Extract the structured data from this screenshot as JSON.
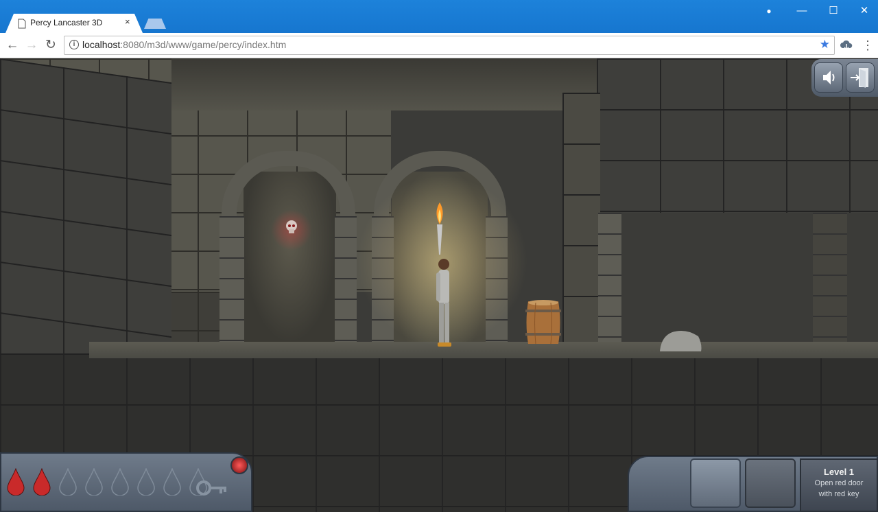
{
  "browser": {
    "tab_title": "Percy Lancaster 3D",
    "tab_close": "×",
    "url_host": "localhost",
    "url_path": ":8080/m3d/www/game/percy/index.htm",
    "info_symbol": "i",
    "bookmark_symbol": "★",
    "back_symbol": "←",
    "forward_symbol": "→",
    "reload_symbol": "↻",
    "menu_symbol": "⋮",
    "account_symbol": "●",
    "minimize_symbol": "—",
    "maximize_symbol": "☐",
    "close_symbol": "✕"
  },
  "hud": {
    "health_total": 8,
    "health_filled": 2,
    "health_color_full": "#c92a2a",
    "health_color_empty": "#7f8b99",
    "key_collected": false,
    "level_title": "Level 1",
    "objective_line1": "Open red door",
    "objective_line2": "with red key",
    "sound_icon": "speaker-icon",
    "exit_icon": "exit-door-icon"
  },
  "scene": {
    "objects": [
      "floating-skull",
      "torch",
      "percy-character",
      "wooden-barrel",
      "boulder"
    ]
  }
}
